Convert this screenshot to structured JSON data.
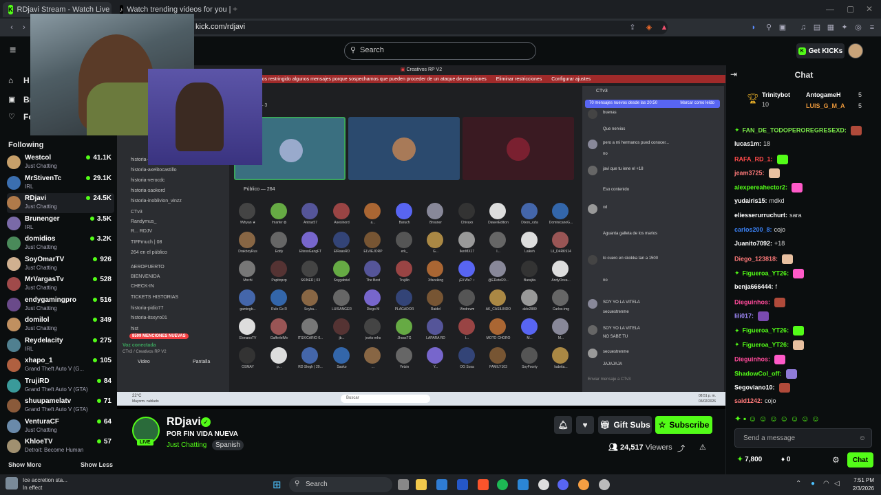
{
  "tabs": [
    {
      "title": "RDjavi Stream - Watch Live o"
    },
    {
      "title": "Watch trending videos for you | TikT"
    }
  ],
  "address": {
    "url": "kick.com/rdjavi"
  },
  "topnav": {
    "search_placeholder": "Search",
    "get_kicks": "Get KICKs"
  },
  "sidebar": {
    "nav": [
      {
        "label": "H"
      },
      {
        "label": "Br"
      },
      {
        "label": "Fo"
      }
    ],
    "following_label": "Following",
    "channels": [
      {
        "name": "Westcol",
        "game": "Just Chatting",
        "viewers": "41.1K"
      },
      {
        "name": "MrStivenTc",
        "game": "IRL",
        "viewers": "29.1K"
      },
      {
        "name": "RDjavi",
        "game": "Just Chatting",
        "viewers": "24.5K"
      },
      {
        "name": "Brunenger",
        "game": "IRL",
        "viewers": "3.5K"
      },
      {
        "name": "domidios",
        "game": "Just Chatting",
        "viewers": "3.2K"
      },
      {
        "name": "SoyOmarTV",
        "game": "Just Chatting",
        "viewers": "926"
      },
      {
        "name": "MrVargasTv",
        "game": "Just Chatting",
        "viewers": "528"
      },
      {
        "name": "endygamingpro",
        "game": "Just Chatting",
        "viewers": "516"
      },
      {
        "name": "domilol",
        "game": "Just Chatting",
        "viewers": "349"
      },
      {
        "name": "Reydelacity",
        "game": "IRL",
        "viewers": "275"
      },
      {
        "name": "xhapo_1",
        "game": "Grand Theft Auto V (G...",
        "viewers": "105"
      },
      {
        "name": "TrujiRD",
        "game": "Grand Theft Auto V (GTA)",
        "viewers": "84"
      },
      {
        "name": "shuupamelatv",
        "game": "Grand Theft Auto V (GTA)",
        "viewers": "71"
      },
      {
        "name": "VenturaCF",
        "game": "Just Chatting",
        "viewers": "64"
      },
      {
        "name": "KhloeTV",
        "game": "Detroit: Become Human",
        "viewers": "57"
      }
    ],
    "show_more": "Show More",
    "show_less": "Show Less"
  },
  "discord": {
    "title": "Creativos RP V2",
    "banner": "Hemos restringido algunos mensajes porque sospechamos que pueden proceder de un ataque de menciones",
    "banner_a": "Eliminar restricciones",
    "banner_b": "Configurar ajustes",
    "channels": [
      "historia-serchrd",
      "historia-axelitocastillo",
      "historia-verocdc",
      "historia-saokord",
      "historia-inoblivion_vinzz",
      "CTv3",
      "Randymus_",
      "R... RDJV",
      "TIFFmuch | 08",
      "264 en el público",
      "AEROPUERTO",
      "BIENVENIDA",
      "CHECK-IN",
      "TICKETS HISTORIAS",
      "historia-pidio77",
      "historia-itsxyro01",
      "hist"
    ],
    "mentions": "8599 MENCIONES NUEVAS",
    "voice": "Voz conectada",
    "voice_sub": "CTv3 / Creativos RP V2",
    "video": "Video",
    "share": "Pantalla",
    "section_top": "s — 3",
    "public": "Público — 264",
    "grid_names": [
      "!Whyan ★",
      "!marfer ✿",
      "Antrax57",
      "Asesinord",
      "a...",
      "Baruch",
      "Brouner",
      "Chivaxx",
      "DawerEdition",
      "Dixon_vzla",
      "DominicanoG...",
      "DrakboyRus",
      "Eddy",
      "EltesoGangFT",
      "ElRaasRD",
      "ELVIEJORP",
      "erk_",
      "G...",
      "IkerMX17",
      "I...",
      "Laikeh",
      "Lil_D4RK914",
      "Mochi",
      "Papitopvp",
      "SKINER | 03",
      "Soygabriel",
      "The Best",
      "Trujillo",
      "Xfaceking",
      "¡Eli Wa? ♀",
      "@EReteR0...",
      "Barajita",
      "AndyOcea...",
      "gamingb...",
      "Rulo Gx R",
      "Soyka...",
      "LUISANGER",
      "Diego M",
      "PLAGADOR",
      "Raidel",
      "!Andrew♥",
      "AK_CASILINDO",
      "aldo2889",
      "Carlos-img",
      "ElenanoTV",
      "GafferlelMv",
      "ITSXICARIO 0...",
      "jb...",
      "jovito mhs",
      "JhossTG",
      "LAPARA RD",
      "l...",
      "MOTO CHORO",
      "M...",
      "M...",
      "OSMAY",
      "p...",
      "RD Skrgh | 20...",
      "Saoko",
      "...",
      "Yetzin",
      "Y...",
      "OG Sosa",
      "FAMILY103",
      "SoyFoorty",
      "kabrita..."
    ],
    "chat_title": "CTv3",
    "new_msgs": "70 mensajes nuevos desde las 20:50",
    "mark_read": "Marcar como leído",
    "messages": [
      "buenas",
      "Que nervios",
      "pero a mi hermanos pued conocer...",
      "no",
      "javi que tu iene el +18",
      "Eso contenido",
      "xd",
      "Aguanta galleta de los marios",
      "lo cuero en skokka tan a 1500",
      "no",
      "SOY YO LA VITELA",
      "secuestrenme",
      "SOY YO LA VITELA",
      "NO SABE TU",
      "secuestrenme",
      "JAJAJAJA"
    ],
    "chat_input": "Enviar mensaje a CTv3",
    "task_search": "Buscar",
    "temp": "22°C",
    "weather": "Mayorm. nublado",
    "time": "08:51 p. m.",
    "date": "03/02/2026"
  },
  "stream": {
    "name": "RDjavi",
    "title": "POR FIN VIDA NUEVA",
    "category": "Just Chatting",
    "language": "Spanish",
    "live": "LIVE",
    "viewers": "24,517",
    "viewers_label": "Viewers",
    "gift": "Gift Subs",
    "subscribe": "Subscribe"
  },
  "chat": {
    "title": "Chat",
    "top": [
      {
        "name": "Trinitybot",
        "count": "10"
      },
      {
        "name": "AntogameH",
        "count": "5"
      },
      {
        "name": "LUIS_G_M_A",
        "count": "5"
      }
    ],
    "messages": [
      {
        "user": "FAN_DE_TODOPEROREGRESEXD:",
        "text": "",
        "color": "#7be84a"
      },
      {
        "user": "lucas1m:",
        "text": "18",
        "color": "#ffffff"
      },
      {
        "user": "RAFA_RD_1:",
        "text": "",
        "color": "#ff4a4a"
      },
      {
        "user": "jeam3725:",
        "text": "",
        "color": "#ff7a7a"
      },
      {
        "user": "alexpereahector2:",
        "text": "",
        "color": "#53fc18"
      },
      {
        "user": "yudairis15:",
        "text": "mdkd",
        "color": "#ffffff"
      },
      {
        "user": "eliesserurruchurt:",
        "text": "sara",
        "color": "#ffffff"
      },
      {
        "user": "carlos200_8:",
        "text": "cojo",
        "color": "#3b82f6"
      },
      {
        "user": "Juanito7092:",
        "text": "+18",
        "color": "#ffffff"
      },
      {
        "user": "Diego_123818:",
        "text": "",
        "color": "#ff7a7a"
      },
      {
        "user": "Figueroa_YT26:",
        "text": "",
        "color": "#53fc18"
      },
      {
        "user": "benja666444:",
        "text": "f",
        "color": "#ffffff"
      },
      {
        "user": "Dieguinhos:",
        "text": "",
        "color": "#ff4a9a"
      },
      {
        "user": "lili017:",
        "text": "",
        "color": "#a38cff"
      },
      {
        "user": "Figueroa_YT26:",
        "text": "",
        "color": "#53fc18"
      },
      {
        "user": "Figueroa_YT26:",
        "text": "",
        "color": "#53fc18"
      },
      {
        "user": "Dieguinhos:",
        "text": "",
        "color": "#ff4a9a"
      },
      {
        "user": "ShadowCol_off:",
        "text": "",
        "color": "#53fc18"
      },
      {
        "user": "Segoviano10:",
        "text": "",
        "color": "#ffffff"
      },
      {
        "user": "said1242:",
        "text": "cojo",
        "color": "#ff7a7a"
      }
    ],
    "input_placeholder": "Send a message",
    "kicks": "7,800",
    "pts": "0",
    "send": "Chat"
  },
  "media": {
    "title": "Ice accretion sta...",
    "sub": "In effect"
  },
  "taskbar": {
    "search": "Search",
    "time": "7:51 PM",
    "date": "2/3/2026"
  }
}
